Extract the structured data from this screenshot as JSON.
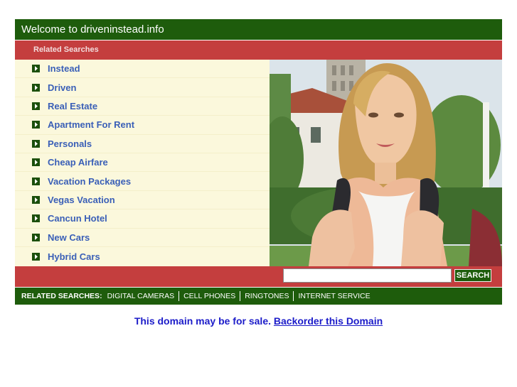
{
  "header": {
    "title": "Welcome to driveninstead.info"
  },
  "related": {
    "heading": "Related Searches"
  },
  "links": [
    "Instead",
    "Driven",
    "Real Estate",
    "Apartment For Rent",
    "Personals",
    "Cheap Airfare",
    "Vacation Packages",
    "Vegas Vacation",
    "Cancun Hotel",
    "New Cars",
    "Hybrid Cars"
  ],
  "search": {
    "value": "",
    "button_label": "SEARCH"
  },
  "bottom": {
    "label": "RELATED SEARCHES:",
    "links": [
      "DIGITAL CAMERAS",
      "CELL PHONES",
      "RINGTONES",
      "INTERNET SERVICE"
    ]
  },
  "sale": {
    "text": "This domain may be for sale.",
    "link": "Backorder this Domain"
  },
  "colors": {
    "green": "#1e5c0c",
    "red": "#c43e3e",
    "cream": "#fbf8dc",
    "link": "#3a5fb7",
    "sale": "#1c1cc9"
  },
  "icons": {
    "bullet": "chevron-right-icon"
  }
}
